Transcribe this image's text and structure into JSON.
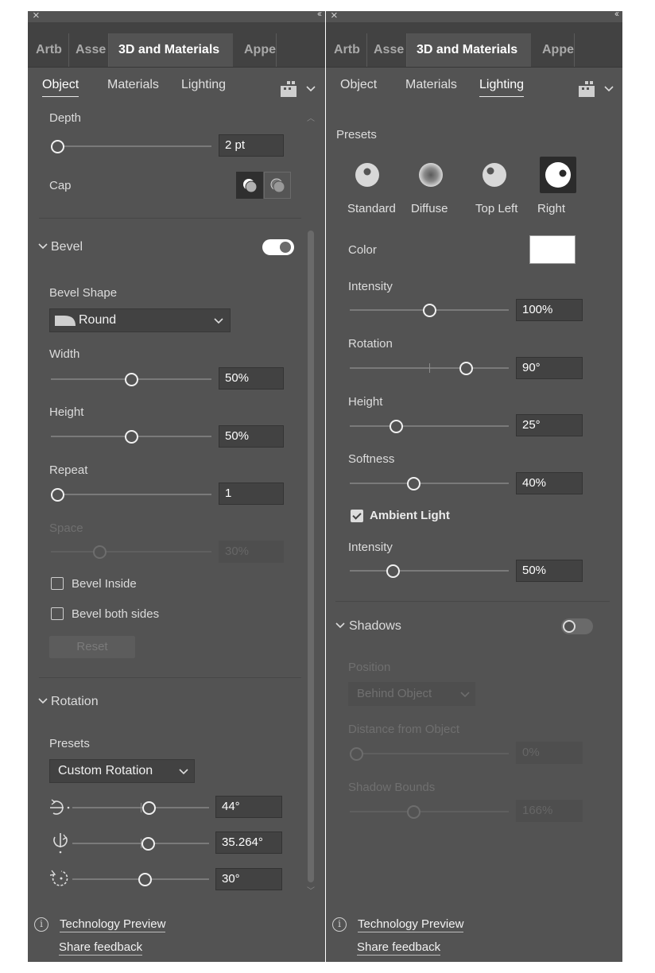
{
  "panel_tabs": [
    "Artb",
    "Asse",
    "3D and Materials",
    "Appe"
  ],
  "subtabs": [
    "Object",
    "Materials",
    "Lighting"
  ],
  "left": {
    "depth": {
      "label": "Depth",
      "value": "2 pt",
      "slider": 0.0
    },
    "cap_label": "Cap",
    "bevel": {
      "header": "Bevel",
      "enabled": true,
      "shape_label": "Bevel Shape",
      "shape_value": "Round",
      "width": {
        "label": "Width",
        "value": "50%",
        "slider": 0.5
      },
      "height": {
        "label": "Height",
        "value": "50%",
        "slider": 0.5
      },
      "repeat": {
        "label": "Repeat",
        "value": "1",
        "slider": 0.0
      },
      "space": {
        "label": "Space",
        "value": "30%",
        "slider": 0.3
      },
      "inside_label": "Bevel Inside",
      "inside_checked": false,
      "both_label": "Bevel both sides",
      "both_checked": false,
      "reset_label": "Reset"
    },
    "rotation": {
      "header": "Rotation",
      "presets_label": "Presets",
      "preset_value": "Custom Rotation",
      "x": {
        "value": "44°",
        "slider": 0.56
      },
      "y": {
        "value": "35.264°",
        "slider": 0.55
      },
      "z": {
        "value": "30°",
        "slider": 0.53
      }
    }
  },
  "right": {
    "presets_label": "Presets",
    "presets": [
      "Standard",
      "Diffuse",
      "Top Left",
      "Right"
    ],
    "selected_preset": "Right",
    "color_label": "Color",
    "light_color": "#ffffff",
    "intensity": {
      "label": "Intensity",
      "value": "100%",
      "slider": 0.5
    },
    "rotation": {
      "label": "Rotation",
      "value": "90°",
      "slider": 0.73
    },
    "height": {
      "label": "Height",
      "value": "25°",
      "slider": 0.29
    },
    "softness": {
      "label": "Softness",
      "value": "40%",
      "slider": 0.4
    },
    "ambient_label": "Ambient Light",
    "ambient_checked": true,
    "ambient_intensity": {
      "label": "Intensity",
      "value": "50%",
      "slider": 0.27
    },
    "shadows": {
      "header": "Shadows",
      "enabled": false,
      "position_label": "Position",
      "position_value": "Behind Object",
      "distance_label": "Distance from Object",
      "distance_value": "0%",
      "distance_slider": 0.0,
      "bounds_label": "Shadow Bounds",
      "bounds_value": "166%",
      "bounds_slider": 0.4
    }
  },
  "footer": {
    "preview": "Technology Preview",
    "feedback": "Share feedback"
  }
}
